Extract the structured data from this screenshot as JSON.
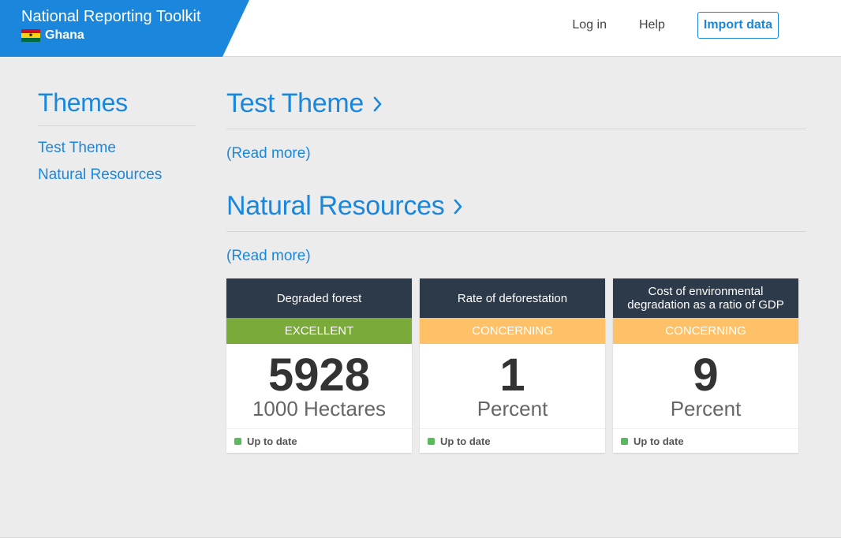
{
  "header": {
    "title": "National Reporting Toolkit",
    "country": "Ghana",
    "flag_icon": "ghana-flag-icon",
    "brand_color": "#1a87dc",
    "nav": {
      "login": "Log in",
      "help": "Help",
      "import": "Import data"
    }
  },
  "sidebar": {
    "title": "Themes",
    "items": [
      {
        "label": "Test Theme"
      },
      {
        "label": "Natural Resources"
      }
    ]
  },
  "themes": [
    {
      "title": "Test Theme",
      "read_more": "(Read more)",
      "indicators": []
    },
    {
      "title": "Natural Resources",
      "read_more": "(Read more)",
      "indicators": [
        {
          "name": "Degraded forest",
          "status": "EXCELLENT",
          "status_color": "#7aaa3a",
          "value": "5928",
          "unit": "1000 Hectares",
          "freshness": "Up to date"
        },
        {
          "name": "Rate of deforestation",
          "status": "CONCERNING",
          "status_color": "#fec167",
          "value": "1",
          "unit": "Percent",
          "freshness": "Up to date"
        },
        {
          "name": "Cost of environmental degradation as a ratio of GDP",
          "status": "CONCERNING",
          "status_color": "#fec167",
          "value": "9",
          "unit": "Percent",
          "freshness": "Up to date"
        }
      ]
    }
  ],
  "colors": {
    "accent": "#1a87dc",
    "card_header": "#2c3a4a",
    "up_to_date_dot": "#5cb85c"
  }
}
